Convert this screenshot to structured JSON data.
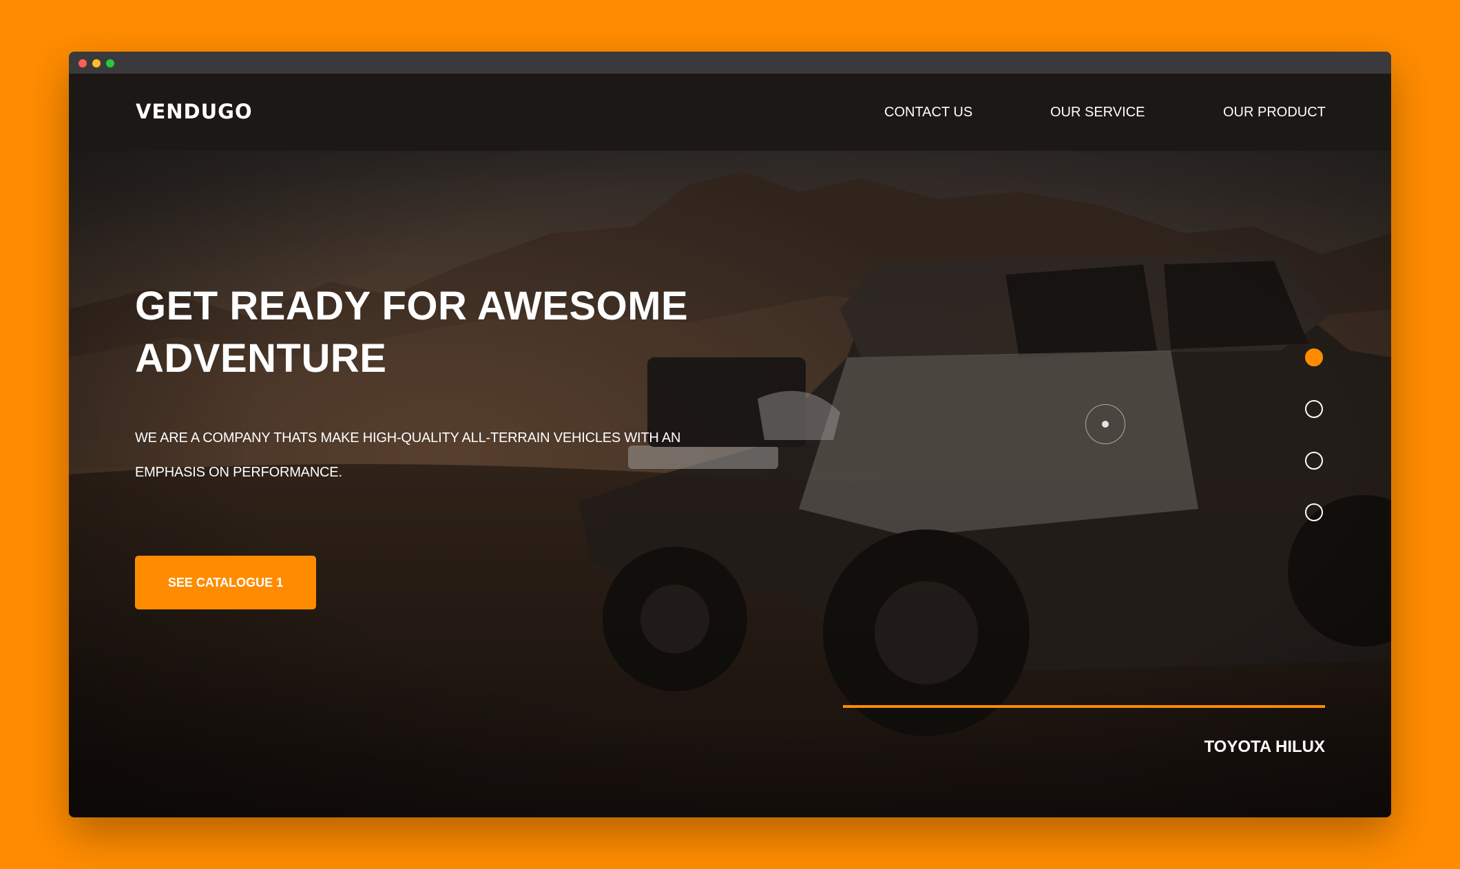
{
  "brand": {
    "logo": "VENDUGO"
  },
  "nav": {
    "items": [
      {
        "label": "CONTACT US"
      },
      {
        "label": "OUR SERVICE"
      },
      {
        "label": "OUR PRODUCT"
      }
    ]
  },
  "hero": {
    "title": "GET READY FOR AWESOME ADVENTURE",
    "description": "WE ARE A COMPANY THATS MAKE HIGH-QUALITY ALL-TERRAIN VEHICLES WITH AN EMPHASIS ON PERFORMANCE.",
    "cta_label": "SEE CATALOGUE 1",
    "product_name": "TOYOTA HILUX",
    "background_scene": "desert-offroad-pickup-truck-photo"
  },
  "slider": {
    "count": 4,
    "active_index": 1
  },
  "colors": {
    "page_background": "#FF8C00",
    "accent": "#FF8C00",
    "navbar": "#1B1816",
    "text": "#FFFFFF"
  }
}
